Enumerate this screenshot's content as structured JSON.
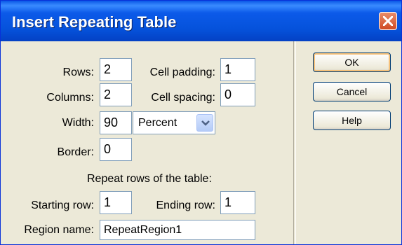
{
  "window": {
    "title": "Insert Repeating Table"
  },
  "form": {
    "rows_label": "Rows:",
    "rows_value": "2",
    "cell_padding_label": "Cell padding:",
    "cell_padding_value": "1",
    "columns_label": "Columns:",
    "columns_value": "2",
    "cell_spacing_label": "Cell spacing:",
    "cell_spacing_value": "0",
    "width_label": "Width:",
    "width_value": "90",
    "width_unit": "Percent",
    "border_label": "Border:",
    "border_value": "0",
    "repeat_heading": "Repeat rows of the table:",
    "starting_row_label": "Starting row:",
    "starting_row_value": "1",
    "ending_row_label": "Ending row:",
    "ending_row_value": "1",
    "region_name_label": "Region name:",
    "region_name_value": "RepeatRegion1"
  },
  "buttons": {
    "ok": "OK",
    "cancel": "Cancel",
    "help": "Help"
  },
  "icons": {
    "close": "close-icon",
    "dropdown": "chevron-down-icon"
  },
  "colors": {
    "titlebar": "#0552db",
    "dialog_bg": "#ece9d8",
    "close_button": "#cf4a24"
  }
}
